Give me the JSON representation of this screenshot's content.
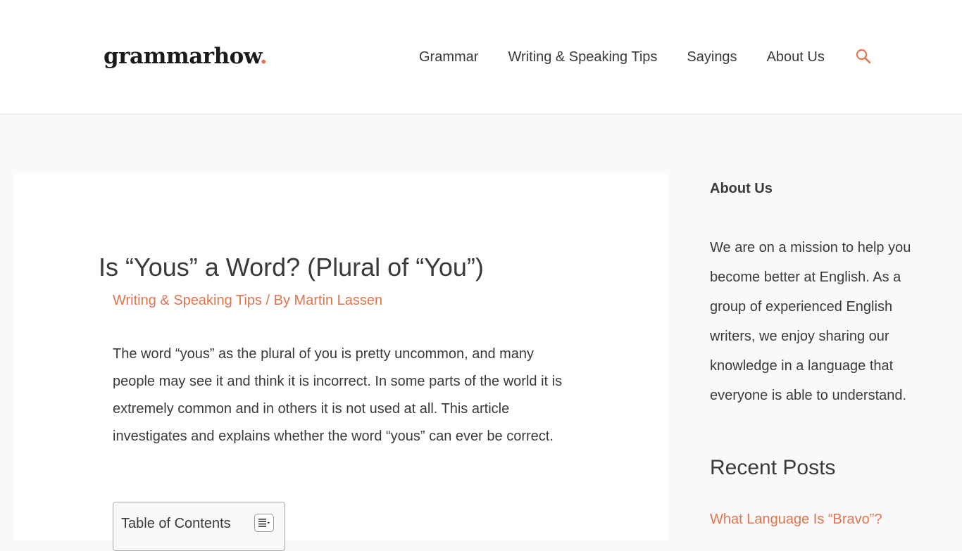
{
  "header": {
    "logo_text": "grammarhow",
    "logo_dot": ".",
    "nav": [
      {
        "label": "Grammar"
      },
      {
        "label": "Writing & Speaking Tips"
      },
      {
        "label": "Sayings"
      },
      {
        "label": "About Us"
      }
    ],
    "search_icon": "search-icon"
  },
  "article": {
    "title": "Is “Yous” a Word? (Plural of “You”)",
    "category": "Writing & Speaking Tips",
    "separator": " / By ",
    "author": "Martin Lassen",
    "intro": "The word “yous” as the plural of you is pretty uncommon, and many people may see it and think it is incorrect. In some parts of the world it is extremely common and in others it is not used at all. This article investigates and explains whether the word “yous” can ever be correct.",
    "toc": {
      "title": "Table of Contents",
      "toggle_icon": "list-toggle-icon"
    }
  },
  "sidebar": {
    "about_heading": "About Us",
    "about_text": "We are on a mission to help you become better at English. As a group of experienced English writers, we enjoy sharing our knowledge in a language that everyone is able to understand.",
    "recent_heading": "Recent Posts",
    "recent_posts": [
      {
        "title": "What Language Is “Bravo”?"
      }
    ]
  },
  "colors": {
    "accent": "#e0744e",
    "text": "#3a3a3a",
    "background": "#f9f9f9",
    "card": "#ffffff"
  }
}
